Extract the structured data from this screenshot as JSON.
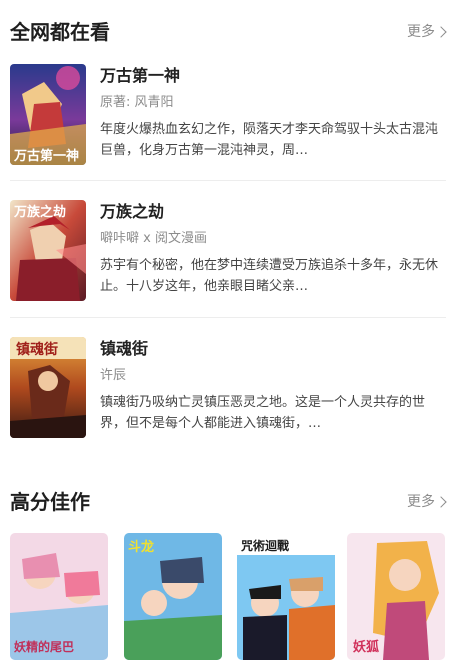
{
  "sections": [
    {
      "title": "全网都在看",
      "more_label": "更多"
    },
    {
      "title": "高分佳作",
      "more_label": "更多"
    }
  ],
  "items": [
    {
      "title": "万古第一神",
      "author": "原著: 风青阳",
      "description": "年度火爆热血玄幻之作，陨落天才李天命驾驭十头太古混沌巨兽，化身万古第一混沌神灵，周…",
      "cover_text": "万古第一神"
    },
    {
      "title": "万族之劫",
      "author": "噼咔噼 x 阅文漫画",
      "description": "苏宇有个秘密，他在梦中连续遭受万族追杀十多年，永无休止。十八岁这年，他亲眼目睹父亲…",
      "cover_text": "万族之劫"
    },
    {
      "title": "镇魂街",
      "author": "许辰",
      "description": "镇魂街乃吸纳亡灵镇压恶灵之地。这是一个人灵共存的世界，但不是每个人都能进入镇魂街，…",
      "cover_text": "镇魂街"
    }
  ],
  "thumbnails": [
    {
      "cover_text": "妖精的尾巴"
    },
    {
      "cover_text": "斗龙"
    },
    {
      "cover_text": "咒術迴戰"
    },
    {
      "cover_text": "妖狐"
    }
  ]
}
